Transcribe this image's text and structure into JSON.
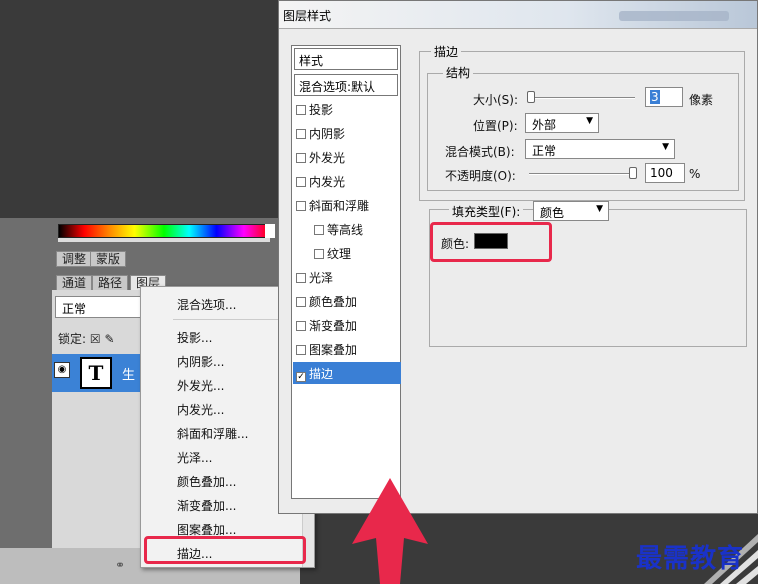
{
  "left_panel": {
    "tabs_row1": [
      "调整",
      "蒙版"
    ],
    "tabs_row2": [
      "通道",
      "路径",
      "图层"
    ],
    "blend_mode": "正常",
    "lock_label": "锁定:",
    "layer_name": "生",
    "layer_thumb_letter": "T"
  },
  "context_menu": {
    "items": [
      "混合选项...",
      "投影...",
      "内阴影...",
      "外发光...",
      "内发光...",
      "斜面和浮雕...",
      "光泽...",
      "颜色叠加...",
      "渐变叠加...",
      "图案叠加...",
      "描边..."
    ]
  },
  "dialog": {
    "title": "图层样式",
    "styles_header": "样式",
    "blend_options": "混合选项:默认",
    "styles": [
      {
        "label": "投影",
        "checked": false
      },
      {
        "label": "内阴影",
        "checked": false
      },
      {
        "label": "外发光",
        "checked": false
      },
      {
        "label": "内发光",
        "checked": false
      },
      {
        "label": "斜面和浮雕",
        "checked": false
      },
      {
        "label": "等高线",
        "checked": false
      },
      {
        "label": "纹理",
        "checked": false
      },
      {
        "label": "光泽",
        "checked": false
      },
      {
        "label": "颜色叠加",
        "checked": false
      },
      {
        "label": "渐变叠加",
        "checked": false
      },
      {
        "label": "图案叠加",
        "checked": false
      },
      {
        "label": "描边",
        "checked": true
      }
    ],
    "stroke_group": "描边",
    "structure_group": "结构",
    "size_label": "大小(S):",
    "size_value": "3",
    "size_unit": "像素",
    "position_label": "位置(P):",
    "position_value": "外部",
    "blend_label": "混合模式(B):",
    "blend_value": "正常",
    "opacity_label": "不透明度(O):",
    "opacity_value": "100",
    "opacity_unit": "%",
    "fill_type_label": "填充类型(F):",
    "fill_type_value": "颜色",
    "color_label": "颜色:",
    "stroke_color": "#000000"
  },
  "watermark": "最需教育"
}
